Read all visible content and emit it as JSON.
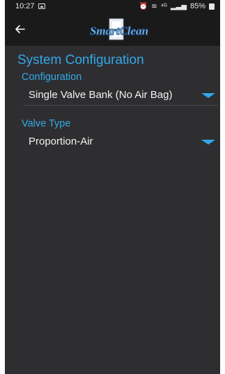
{
  "status_bar": {
    "time": "10:27",
    "signal_text": "⁴ᴳ",
    "battery": "85%"
  },
  "app_bar": {
    "back_icon": "arrow-left-icon",
    "logo_text": "SmartClean"
  },
  "screen": {
    "title": "System Configuration",
    "configuration": {
      "label": "Configuration",
      "selected": "Single Valve Bank (No Air Bag)"
    },
    "valve_type": {
      "label": "Valve Type",
      "selected": "Proportion-Air"
    }
  },
  "colors": {
    "accent": "#33a8ea",
    "background": "#2e2e30",
    "bar": "#1a1a1a",
    "text": "#f2f2f2"
  }
}
